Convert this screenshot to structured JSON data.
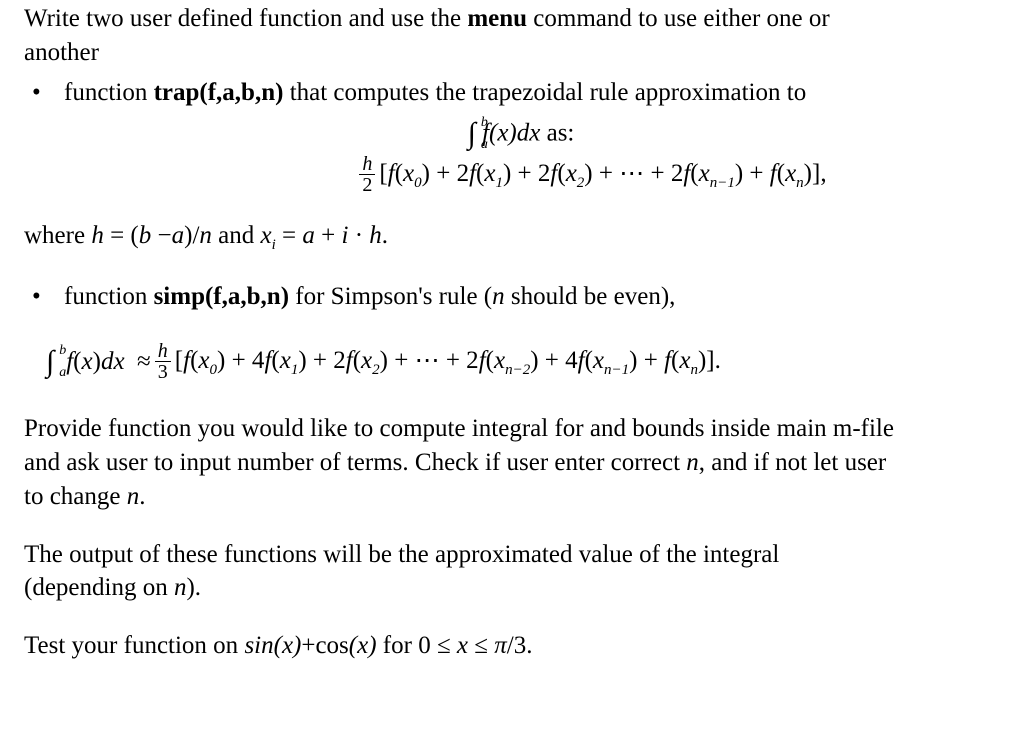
{
  "intro": {
    "line1_a": "Write two user defined function and use the ",
    "line1_b": "menu",
    "line1_c": " command to use either one or",
    "line2": "another"
  },
  "bullet1": {
    "pre": "function ",
    "fn": "trap(f,a,b,n)",
    "post": " that computes the trapezoidal rule approximation to"
  },
  "intline": {
    "int": "∫",
    "lb": "a",
    "ub": "b",
    "body": "  f(x)dx",
    "as": " as:"
  },
  "trapformula": {
    "h": "h",
    "two": "2",
    "body": "[f(x₀) + 2f(x₁) + 2f(x₂) + ⋯ + 2f(xₙ₋₁) + f(xₙ)],"
  },
  "where": {
    "a": "where ",
    "b": "h = (b −a)/n ",
    "c": "and ",
    "d": "xᵢ = a + i · h.",
    "sub_i": "i"
  },
  "bullet2": {
    "pre": "function ",
    "fn": "simp(f,a,b,n)",
    "post_a": " for Simpson's rule (",
    "post_b": "n ",
    "post_c": "should be even),"
  },
  "simpformula": {
    "int": "∫",
    "lb": "a",
    "ub": "b",
    "lhs": "  f(x)dx  ≈ ",
    "h": "h",
    "three": "3",
    "body": "[f(x₀) + 4f(x₁) + 2f(x₂) + ⋯ + 2f(xₙ₋₂) + 4f(xₙ₋₁) + f(xₙ)]."
  },
  "para2": {
    "l1_a": "Provide function you would like to compute integral for and bounds inside main m-file",
    "l2_a": "and ask user to input number of terms. Check if user enter correct ",
    "l2_b": "n",
    "l2_c": ", and if not let user",
    "l3": "to change ",
    "l3_b": "n",
    "l3_c": "."
  },
  "para3": {
    "l1": "The output of these functions will be the approximated value of the integral",
    "l2_a": "(depending on ",
    "l2_b": "n",
    "l2_c": ")."
  },
  "para4": {
    "a": "Test your function on ",
    "b": "sin(x)",
    "c": "+cos",
    "d": "(x)",
    "e": " for 0 ≤ ",
    "f": "x ",
    "g": "≤ ",
    "h": "π",
    "i": "/3."
  }
}
